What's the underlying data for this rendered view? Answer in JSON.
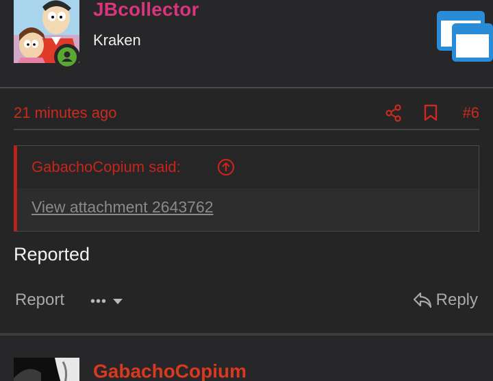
{
  "post": {
    "username": "JBcollector",
    "user_title": "Kraken",
    "time": "21 minutes ago",
    "post_number": "#6",
    "quote": {
      "author": "GabachoCopium said:",
      "attachment": "View attachment 2643762"
    },
    "body": "Reported",
    "actions": {
      "report": "Report",
      "more": "•••",
      "reply": "Reply"
    }
  },
  "next_post": {
    "username": "GabachoCopium"
  },
  "colors": {
    "username": "#d8357c",
    "accent_red": "#cc2a1f",
    "online": "#5aa832",
    "background": "#252526"
  },
  "icons": [
    "avatar",
    "online-icon",
    "window-icon",
    "share-icon",
    "bookmark-icon",
    "expand-quote-icon",
    "chevron-down-icon",
    "reply-icon"
  ]
}
